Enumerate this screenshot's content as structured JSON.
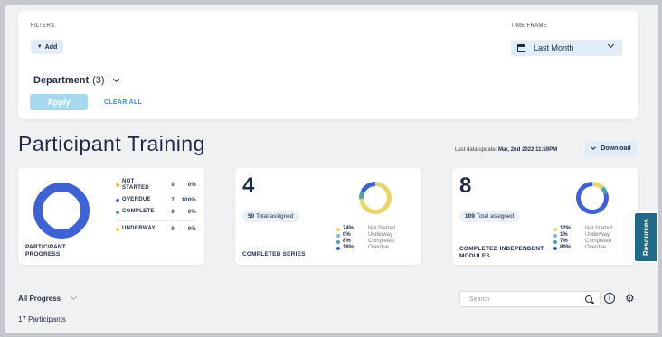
{
  "filters": {
    "caption": "FILTERS",
    "add_label": "Add",
    "department_label": "Department",
    "department_count": "(3)",
    "apply_label": "Apply",
    "clear_all_label": "CLEAR ALL"
  },
  "timeframe": {
    "caption": "TIME FRAME",
    "value": "Last Month"
  },
  "header": {
    "title": "Participant Training",
    "last_update_label": "Last data update:",
    "last_update_value": "Mar, 2nd 2022 11:59PM",
    "download_label": "Download"
  },
  "progress_card": {
    "label_line1": "PARTICIPANT",
    "label_line2": "PROGRESS",
    "rows": [
      {
        "name_line1": "NOT",
        "name_line2": "STARTED",
        "count": "0",
        "pct": "0%",
        "color": "#e8c53a",
        "value": 0
      },
      {
        "name_line1": "OVERDUE",
        "name_line2": "",
        "count": "7",
        "pct": "100%",
        "color": "#3f62d3",
        "value": 7
      },
      {
        "name_line1": "COMPLETE",
        "name_line2": "",
        "count": "0",
        "pct": "0%",
        "color": "#4fa3a8",
        "value": 0
      },
      {
        "name_line1": "UNDERWAY",
        "name_line2": "",
        "count": "0",
        "pct": "0%",
        "color": "#e8d63a",
        "value": 0
      }
    ]
  },
  "series_card": {
    "number": "4",
    "total_count": "50",
    "total_label": "Total assigned",
    "label": "COMPLETED SERIES",
    "legend": [
      {
        "pct": "74%",
        "name": "Not Started",
        "color": "#e8d56b",
        "value": 74
      },
      {
        "pct": "0%",
        "name": "Underway",
        "color": "#7fb8d8",
        "value": 0
      },
      {
        "pct": "8%",
        "name": "Completed",
        "color": "#4fa3a8",
        "value": 8
      },
      {
        "pct": "18%",
        "name": "Overdue",
        "color": "#3f62d3",
        "value": 18
      }
    ]
  },
  "modules_card": {
    "number": "8",
    "total_count": "109",
    "total_label": "Total assigned",
    "label_line1": "COMPLETED INDEPENDENT",
    "label_line2": "MODULES",
    "legend": [
      {
        "pct": "12%",
        "name": "Not Started",
        "color": "#e8d56b",
        "value": 12
      },
      {
        "pct": "1%",
        "name": "Underway",
        "color": "#7fb8d8",
        "value": 1
      },
      {
        "pct": "7%",
        "name": "Completed",
        "color": "#4fa3a8",
        "value": 7
      },
      {
        "pct": "80%",
        "name": "Overdue",
        "color": "#3f62d3",
        "value": 80
      }
    ]
  },
  "resources_label": "Resources",
  "table_controls": {
    "progress_select": "All Progress",
    "participants_count": "17 Participants",
    "search_placeholder": "Search"
  }
}
